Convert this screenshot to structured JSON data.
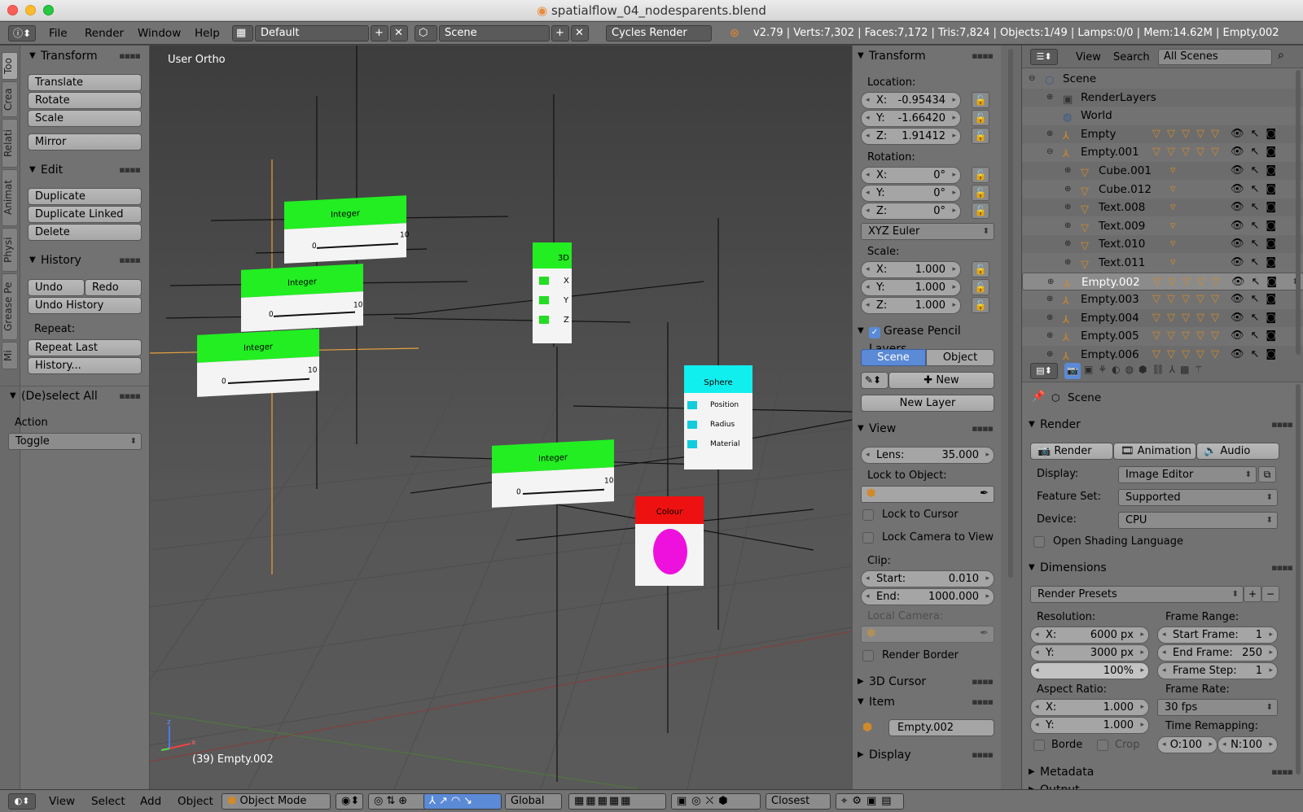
{
  "window": {
    "title": "spatialflow_04_nodesparents.blend"
  },
  "info": {
    "menus": [
      "File",
      "Render",
      "Window",
      "Help"
    ],
    "screen": "Default",
    "scene": "Scene",
    "engine": "Cycles Render",
    "stats": "v2.79 | Verts:7,302 | Faces:7,172 | Tris:7,824 | Objects:1/49 | Lamps:0/0 | Mem:14.62M | Empty.002"
  },
  "toolshelf": {
    "tabs": [
      "Too",
      "Crea",
      "Relati",
      "Animat",
      "Physi",
      "Grease Pe",
      "Mi"
    ],
    "transform": {
      "title": "Transform",
      "buttons": [
        "Translate",
        "Rotate",
        "Scale",
        "Mirror"
      ]
    },
    "edit": {
      "title": "Edit",
      "buttons": [
        "Duplicate",
        "Duplicate Linked",
        "Delete"
      ]
    },
    "history": {
      "title": "History",
      "undo": "Undo",
      "redo": "Redo",
      "undo_history": "Undo History",
      "repeat_label": "Repeat:",
      "repeat_last": "Repeat Last",
      "history_btn": "History..."
    },
    "deselect": {
      "title": "(De)select All",
      "action_label": "Action",
      "action_value": "Toggle"
    }
  },
  "viewport": {
    "view_name": "User Ortho",
    "status": "(39) Empty.002",
    "nodes": [
      {
        "label": "Integer",
        "min": "0",
        "max": "10"
      },
      {
        "label": "Integer",
        "min": "0",
        "max": "10"
      },
      {
        "label": "Integer",
        "min": "0",
        "max": "10"
      },
      {
        "label": "Integer",
        "min": "0",
        "max": "10"
      },
      {
        "label": "3D",
        "axes": [
          "X",
          "Y",
          "Z"
        ]
      },
      {
        "label": "Sphere",
        "rows": [
          "Position",
          "Radius",
          "Material"
        ]
      },
      {
        "label": "Colour"
      }
    ]
  },
  "npanel": {
    "transform": {
      "title": "Transform",
      "location_label": "Location:",
      "location": [
        {
          "k": "X:",
          "v": "-0.95434"
        },
        {
          "k": "Y:",
          "v": "-1.66420"
        },
        {
          "k": "Z:",
          "v": "1.91412"
        }
      ],
      "rotation_label": "Rotation:",
      "rotation": [
        {
          "k": "X:",
          "v": "0°"
        },
        {
          "k": "Y:",
          "v": "0°"
        },
        {
          "k": "Z:",
          "v": "0°"
        }
      ],
      "rotation_mode": "XYZ Euler",
      "scale_label": "Scale:",
      "scale": [
        {
          "k": "X:",
          "v": "1.000"
        },
        {
          "k": "Y:",
          "v": "1.000"
        },
        {
          "k": "Z:",
          "v": "1.000"
        }
      ]
    },
    "grease": {
      "title": "Grease Pencil Layers",
      "tab_scene": "Scene",
      "tab_object": "Object",
      "new": "New",
      "new_layer": "New Layer"
    },
    "view": {
      "title": "View",
      "lens_k": "Lens:",
      "lens_v": "35.000",
      "lock_obj_label": "Lock to Object:",
      "lock_cursor": "Lock to Cursor",
      "lock_camera": "Lock Camera to View",
      "clip_label": "Clip:",
      "clip_start_k": "Start:",
      "clip_start_v": "0.010",
      "clip_end_k": "End:",
      "clip_end_v": "1000.000",
      "local_camera": "Local Camera:",
      "render_border": "Render Border"
    },
    "cursor3d": {
      "title": "3D Cursor"
    },
    "item": {
      "title": "Item",
      "name": "Empty.002"
    },
    "display": {
      "title": "Display"
    }
  },
  "outliner": {
    "view": "View",
    "search": "Search",
    "filter": "All Scenes",
    "rows": [
      {
        "name": "Scene",
        "indent": 0,
        "icon": "scene"
      },
      {
        "name": "RenderLayers",
        "indent": 1,
        "icon": "renderlayers"
      },
      {
        "name": "World",
        "indent": 1,
        "icon": "world"
      },
      {
        "name": "Empty",
        "indent": 1,
        "icon": "empty"
      },
      {
        "name": "Empty.001",
        "indent": 1,
        "icon": "empty"
      },
      {
        "name": "Cube.001",
        "indent": 2,
        "icon": "mesh"
      },
      {
        "name": "Cube.012",
        "indent": 2,
        "icon": "mesh"
      },
      {
        "name": "Text.008",
        "indent": 2,
        "icon": "mesh"
      },
      {
        "name": "Text.009",
        "indent": 2,
        "icon": "mesh"
      },
      {
        "name": "Text.010",
        "indent": 2,
        "icon": "mesh"
      },
      {
        "name": "Text.011",
        "indent": 2,
        "icon": "mesh"
      },
      {
        "name": "Empty.002",
        "indent": 1,
        "icon": "empty",
        "selected": true
      },
      {
        "name": "Empty.003",
        "indent": 1,
        "icon": "empty"
      },
      {
        "name": "Empty.004",
        "indent": 1,
        "icon": "empty"
      },
      {
        "name": "Empty.005",
        "indent": 1,
        "icon": "empty"
      },
      {
        "name": "Empty.006",
        "indent": 1,
        "icon": "empty"
      }
    ]
  },
  "properties": {
    "scene": "Scene",
    "render": {
      "title": "Render",
      "render_btn": "Render",
      "animation_btn": "Animation",
      "audio_btn": "Audio",
      "display_label": "Display:",
      "display_value": "Image Editor",
      "feature_label": "Feature Set:",
      "feature_value": "Supported",
      "device_label": "Device:",
      "device_value": "CPU",
      "osl": "Open Shading Language"
    },
    "dimensions": {
      "title": "Dimensions",
      "presets": "Render Presets",
      "resolution_label": "Resolution:",
      "res_x_k": "X:",
      "res_x_v": "6000 px",
      "res_y_k": "Y:",
      "res_y_v": "3000 px",
      "res_pct": "100%",
      "frame_range_label": "Frame Range:",
      "start_k": "Start Frame:",
      "start_v": "1",
      "end_k": "End Frame:",
      "end_v": "250",
      "step_k": "Frame Step:",
      "step_v": "1",
      "aspect_label": "Aspect Ratio:",
      "asp_x_k": "X:",
      "asp_x_v": "1.000",
      "asp_y_k": "Y:",
      "asp_y_v": "1.000",
      "frame_rate_label": "Frame Rate:",
      "frame_rate_value": "30 fps",
      "time_remap_label": "Time Remapping:",
      "border": "Borde",
      "crop": "Crop",
      "old": "O:100",
      "new": "N:100"
    },
    "metadata": {
      "title": "Metadata"
    },
    "output": {
      "title": "Output"
    }
  },
  "bottombar": {
    "menus": [
      "View",
      "Select",
      "Add",
      "Object"
    ],
    "mode": "Object Mode",
    "orientation": "Global",
    "snap": "Closest"
  }
}
